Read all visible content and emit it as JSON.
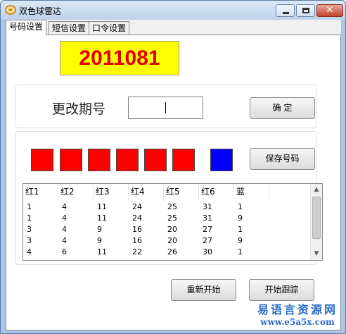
{
  "window": {
    "title": "双色球雷达",
    "close_glyph": "✕"
  },
  "tabs": [
    {
      "label": "号码设置",
      "active": true
    },
    {
      "label": "短信设置",
      "active": false
    },
    {
      "label": "口令设置",
      "active": false
    }
  ],
  "period": {
    "number": "2011081",
    "text_color": "#e00000",
    "bg_color": "#ffff00"
  },
  "change": {
    "label": "更改期号",
    "input_value": "",
    "confirm_label": "确 定"
  },
  "balls": {
    "red_count": 6,
    "blue_count": 1,
    "red_color": "#ff0000",
    "blue_color": "#0000ff",
    "save_label": "保存号码"
  },
  "table": {
    "headers": [
      "红1",
      "红2",
      "红3",
      "红4",
      "红5",
      "红6",
      "蓝"
    ],
    "rows": [
      [
        "1",
        "4",
        "11",
        "24",
        "25",
        "31",
        "1"
      ],
      [
        "1",
        "4",
        "11",
        "24",
        "25",
        "31",
        "9"
      ],
      [
        "3",
        "4",
        "9",
        "16",
        "20",
        "27",
        "1"
      ],
      [
        "3",
        "4",
        "9",
        "16",
        "20",
        "27",
        "9"
      ],
      [
        "4",
        "6",
        "11",
        "22",
        "26",
        "30",
        "1"
      ]
    ]
  },
  "actions": {
    "restart_label": "重新开始",
    "track_label": "开始跟踪"
  },
  "watermark": {
    "name": "易语言资源网",
    "url": "www.e5a5x.com"
  }
}
